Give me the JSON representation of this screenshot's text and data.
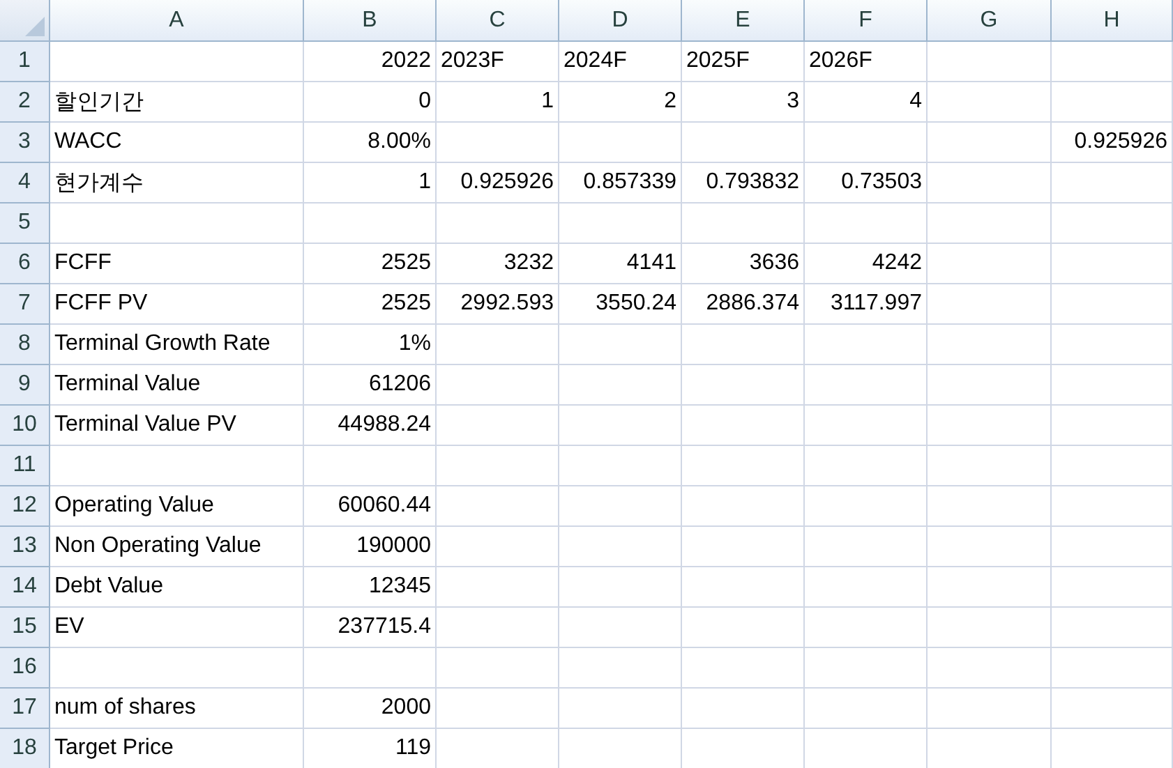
{
  "columns": [
    "A",
    "B",
    "C",
    "D",
    "E",
    "F",
    "G",
    "H"
  ],
  "rows": [
    {
      "number": "1",
      "cells": [
        {
          "kind": "empty"
        },
        {
          "kind": "number",
          "text": "2022"
        },
        {
          "kind": "text",
          "text": "2023F"
        },
        {
          "kind": "text",
          "text": "2024F"
        },
        {
          "kind": "text",
          "text": "2025F"
        },
        {
          "kind": "text",
          "text": "2026F"
        },
        {
          "kind": "empty"
        },
        {
          "kind": "empty"
        }
      ]
    },
    {
      "number": "2",
      "cells": [
        {
          "kind": "text",
          "text": "할인기간"
        },
        {
          "kind": "number",
          "text": "0"
        },
        {
          "kind": "number",
          "text": "1"
        },
        {
          "kind": "number",
          "text": "2"
        },
        {
          "kind": "number",
          "text": "3"
        },
        {
          "kind": "number",
          "text": "4"
        },
        {
          "kind": "empty"
        },
        {
          "kind": "empty"
        }
      ]
    },
    {
      "number": "3",
      "cells": [
        {
          "kind": "text",
          "text": "WACC"
        },
        {
          "kind": "number",
          "text": "8.00%"
        },
        {
          "kind": "empty"
        },
        {
          "kind": "empty"
        },
        {
          "kind": "empty"
        },
        {
          "kind": "empty"
        },
        {
          "kind": "empty"
        },
        {
          "kind": "number",
          "text": "0.925926"
        }
      ]
    },
    {
      "number": "4",
      "cells": [
        {
          "kind": "text",
          "text": "현가계수"
        },
        {
          "kind": "number",
          "text": "1"
        },
        {
          "kind": "number",
          "text": "0.925926"
        },
        {
          "kind": "number",
          "text": "0.857339"
        },
        {
          "kind": "number",
          "text": "0.793832"
        },
        {
          "kind": "number",
          "text": "0.73503"
        },
        {
          "kind": "empty"
        },
        {
          "kind": "empty"
        }
      ]
    },
    {
      "number": "5",
      "cells": [
        {
          "kind": "empty"
        },
        {
          "kind": "empty"
        },
        {
          "kind": "empty"
        },
        {
          "kind": "empty"
        },
        {
          "kind": "empty"
        },
        {
          "kind": "empty"
        },
        {
          "kind": "empty"
        },
        {
          "kind": "empty"
        }
      ]
    },
    {
      "number": "6",
      "cells": [
        {
          "kind": "text",
          "text": "FCFF"
        },
        {
          "kind": "number",
          "text": "2525"
        },
        {
          "kind": "number",
          "text": "3232"
        },
        {
          "kind": "number",
          "text": "4141"
        },
        {
          "kind": "number",
          "text": "3636"
        },
        {
          "kind": "number",
          "text": "4242"
        },
        {
          "kind": "empty"
        },
        {
          "kind": "empty"
        }
      ]
    },
    {
      "number": "7",
      "cells": [
        {
          "kind": "text",
          "text": "FCFF PV"
        },
        {
          "kind": "number",
          "text": "2525"
        },
        {
          "kind": "number",
          "text": "2992.593"
        },
        {
          "kind": "number",
          "text": "3550.24"
        },
        {
          "kind": "number",
          "text": "2886.374"
        },
        {
          "kind": "number",
          "text": "3117.997"
        },
        {
          "kind": "empty"
        },
        {
          "kind": "empty"
        }
      ]
    },
    {
      "number": "8",
      "cells": [
        {
          "kind": "text",
          "text": "Terminal Growth Rate"
        },
        {
          "kind": "number",
          "text": "1%"
        },
        {
          "kind": "empty"
        },
        {
          "kind": "empty"
        },
        {
          "kind": "empty"
        },
        {
          "kind": "empty"
        },
        {
          "kind": "empty"
        },
        {
          "kind": "empty"
        }
      ]
    },
    {
      "number": "9",
      "cells": [
        {
          "kind": "text",
          "text": "Terminal Value"
        },
        {
          "kind": "number",
          "text": "61206"
        },
        {
          "kind": "empty"
        },
        {
          "kind": "empty"
        },
        {
          "kind": "empty"
        },
        {
          "kind": "empty"
        },
        {
          "kind": "empty"
        },
        {
          "kind": "empty"
        }
      ]
    },
    {
      "number": "10",
      "cells": [
        {
          "kind": "text",
          "text": "Terminal Value PV"
        },
        {
          "kind": "number",
          "text": "44988.24"
        },
        {
          "kind": "empty"
        },
        {
          "kind": "empty"
        },
        {
          "kind": "empty"
        },
        {
          "kind": "empty"
        },
        {
          "kind": "empty"
        },
        {
          "kind": "empty"
        }
      ]
    },
    {
      "number": "11",
      "cells": [
        {
          "kind": "empty"
        },
        {
          "kind": "empty"
        },
        {
          "kind": "empty"
        },
        {
          "kind": "empty"
        },
        {
          "kind": "empty"
        },
        {
          "kind": "empty"
        },
        {
          "kind": "empty"
        },
        {
          "kind": "empty"
        }
      ]
    },
    {
      "number": "12",
      "cells": [
        {
          "kind": "text",
          "text": "Operating Value"
        },
        {
          "kind": "number",
          "text": "60060.44"
        },
        {
          "kind": "empty"
        },
        {
          "kind": "empty"
        },
        {
          "kind": "empty"
        },
        {
          "kind": "empty"
        },
        {
          "kind": "empty"
        },
        {
          "kind": "empty"
        }
      ]
    },
    {
      "number": "13",
      "cells": [
        {
          "kind": "text",
          "text": "Non Operating Value"
        },
        {
          "kind": "number",
          "text": "190000"
        },
        {
          "kind": "empty"
        },
        {
          "kind": "empty"
        },
        {
          "kind": "empty"
        },
        {
          "kind": "empty"
        },
        {
          "kind": "empty"
        },
        {
          "kind": "empty"
        }
      ]
    },
    {
      "number": "14",
      "cells": [
        {
          "kind": "text",
          "text": "Debt Value"
        },
        {
          "kind": "number",
          "text": "12345"
        },
        {
          "kind": "empty"
        },
        {
          "kind": "empty"
        },
        {
          "kind": "empty"
        },
        {
          "kind": "empty"
        },
        {
          "kind": "empty"
        },
        {
          "kind": "empty"
        }
      ]
    },
    {
      "number": "15",
      "cells": [
        {
          "kind": "text",
          "text": "EV"
        },
        {
          "kind": "number",
          "text": "237715.4"
        },
        {
          "kind": "empty"
        },
        {
          "kind": "empty"
        },
        {
          "kind": "empty"
        },
        {
          "kind": "empty"
        },
        {
          "kind": "empty"
        },
        {
          "kind": "empty"
        }
      ]
    },
    {
      "number": "16",
      "cells": [
        {
          "kind": "empty"
        },
        {
          "kind": "empty"
        },
        {
          "kind": "empty"
        },
        {
          "kind": "empty"
        },
        {
          "kind": "empty"
        },
        {
          "kind": "empty"
        },
        {
          "kind": "empty"
        },
        {
          "kind": "empty"
        }
      ]
    },
    {
      "number": "17",
      "cells": [
        {
          "kind": "text",
          "text": "num of shares"
        },
        {
          "kind": "number",
          "text": "2000"
        },
        {
          "kind": "empty"
        },
        {
          "kind": "empty"
        },
        {
          "kind": "empty"
        },
        {
          "kind": "empty"
        },
        {
          "kind": "empty"
        },
        {
          "kind": "empty"
        }
      ]
    },
    {
      "number": "18",
      "cells": [
        {
          "kind": "text",
          "text": "Target Price"
        },
        {
          "kind": "number",
          "text": "119"
        },
        {
          "kind": "empty"
        },
        {
          "kind": "empty"
        },
        {
          "kind": "empty"
        },
        {
          "kind": "empty"
        },
        {
          "kind": "empty"
        },
        {
          "kind": "empty"
        }
      ]
    }
  ]
}
